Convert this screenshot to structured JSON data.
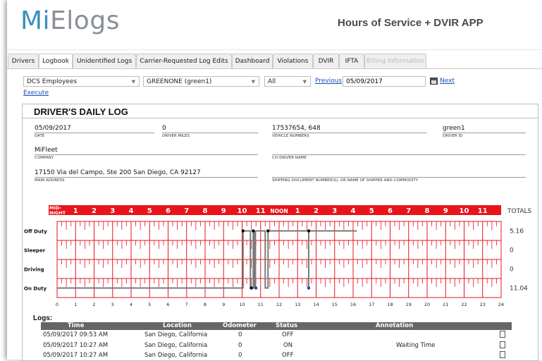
{
  "app": {
    "logo_prefix": "Mi",
    "logo_suffix": "Elogs",
    "title": "Hours of Service + DVIR APP"
  },
  "tabs": [
    {
      "label": "Drivers",
      "state": "normal"
    },
    {
      "label": "Logbook",
      "state": "active"
    },
    {
      "label": "Unidentified Logs",
      "state": "normal"
    },
    {
      "label": "Carrier-Requested Log Edits",
      "state": "normal"
    },
    {
      "label": "Dashboard",
      "state": "normal"
    },
    {
      "label": "Violations",
      "state": "normal"
    },
    {
      "label": "DVIR",
      "state": "normal"
    },
    {
      "label": "IFTA",
      "state": "normal"
    },
    {
      "label": "Billing Information",
      "state": "disabled"
    }
  ],
  "filters": {
    "group": "DCS Employees",
    "driver": "GREENONE (green1)",
    "status": "All",
    "previous_label": "Previous",
    "date": "05/09/2017",
    "next_label": "Next",
    "execute_label": "Execute"
  },
  "log": {
    "title": "DRIVER'S DAILY LOG",
    "date": "05/09/2017",
    "date_label": "DATE",
    "driver_miles": "0",
    "driver_miles_label": "DRIVER MILES",
    "vehicle_numbers": "17537654, 648",
    "vehicle_numbers_label": "VEHICLE NUMBERS",
    "driver_id": "green1",
    "driver_id_label": "DRIVER ID",
    "company": "MiFleet",
    "company_label": "COMPANY",
    "co_driver": "",
    "co_driver_label": "CO-DRIVER NAME",
    "address": "17150 Via del Campo, Ste 200 San Diego, CA 92127",
    "address_label": "MAIN ADDRESS",
    "shipping": "",
    "shipping_label": "SHIPPING DOCUMENT NUMBER(S), OR NAME OF SHIPPER AND COMMODITY"
  },
  "grid": {
    "header_hours": [
      "1",
      "2",
      "3",
      "4",
      "5",
      "6",
      "7",
      "8",
      "9",
      "10",
      "11",
      "NOON",
      "1",
      "2",
      "3",
      "4",
      "5",
      "6",
      "7",
      "8",
      "9",
      "10",
      "11"
    ],
    "midnight_top": "MID-",
    "midnight_bottom": "NIGHT",
    "totals_label": "TOTALS",
    "rows": [
      "Off Duty",
      "Sleeper",
      "Driving",
      "On Duty"
    ],
    "totals": [
      "5.16",
      "0",
      "0",
      "11.04"
    ],
    "axis_hours": [
      "0",
      "1",
      "2",
      "3",
      "4",
      "5",
      "6",
      "7",
      "8",
      "9",
      "10",
      "11",
      "12",
      "13",
      "14",
      "15",
      "16",
      "17",
      "18",
      "19",
      "20",
      "21",
      "22",
      "23",
      "24"
    ],
    "accent_color": "#e8141c",
    "duty_path": [
      {
        "hour": 0.0,
        "row": 3
      },
      {
        "hour": 10.05,
        "row": 3
      },
      {
        "hour": 10.05,
        "row": 0
      },
      {
        "hour": 10.45,
        "row": 0
      },
      {
        "hour": 10.45,
        "row": 3
      },
      {
        "hour": 10.6,
        "row": 3
      },
      {
        "hour": 10.6,
        "row": 0
      },
      {
        "hour": 10.65,
        "row": 0
      },
      {
        "hour": 10.65,
        "row": 3
      },
      {
        "hour": 10.72,
        "row": 3
      },
      {
        "hour": 10.72,
        "row": 0
      },
      {
        "hour": 11.25,
        "row": 0
      },
      {
        "hour": 11.25,
        "row": 3
      },
      {
        "hour": 11.4,
        "row": 3
      },
      {
        "hour": 11.4,
        "row": 0
      },
      {
        "hour": 13.6,
        "row": 0
      },
      {
        "hour": 13.6,
        "row": 3
      },
      {
        "hour": 13.6,
        "row": 0
      },
      {
        "hour": 16.2,
        "row": 0
      }
    ],
    "markers": [
      {
        "hour": 10.05,
        "row": 0,
        "color": "#000000"
      },
      {
        "hour": 10.6,
        "row": 0,
        "color": "#000000"
      },
      {
        "hour": 11.4,
        "row": 0,
        "color": "#000000"
      },
      {
        "hour": 13.6,
        "row": 0,
        "color": "#000000"
      },
      {
        "hour": 10.5,
        "row": 3,
        "color": "#000000"
      },
      {
        "hour": 10.75,
        "row": 3,
        "color": "#1f3fd6"
      },
      {
        "hour": 13.6,
        "row": 3,
        "color": "#1f3fd6"
      }
    ]
  },
  "logs": {
    "title": "Logs:",
    "headers": [
      "Time",
      "Location",
      "Odometer",
      "Status",
      "Annotation"
    ],
    "rows": [
      {
        "time": "05/09/2017 09:53 AM",
        "location": "San Diego, California",
        "odometer": "0",
        "status": "OFF",
        "annotation": ""
      },
      {
        "time": "05/09/2017 10:27 AM",
        "location": "San Diego, California",
        "odometer": "0",
        "status": "ON",
        "annotation": "Waiting Time"
      },
      {
        "time": "05/09/2017 10:27 AM",
        "location": "San Diego, California",
        "odometer": "0",
        "status": "OFF",
        "annotation": ""
      }
    ]
  }
}
